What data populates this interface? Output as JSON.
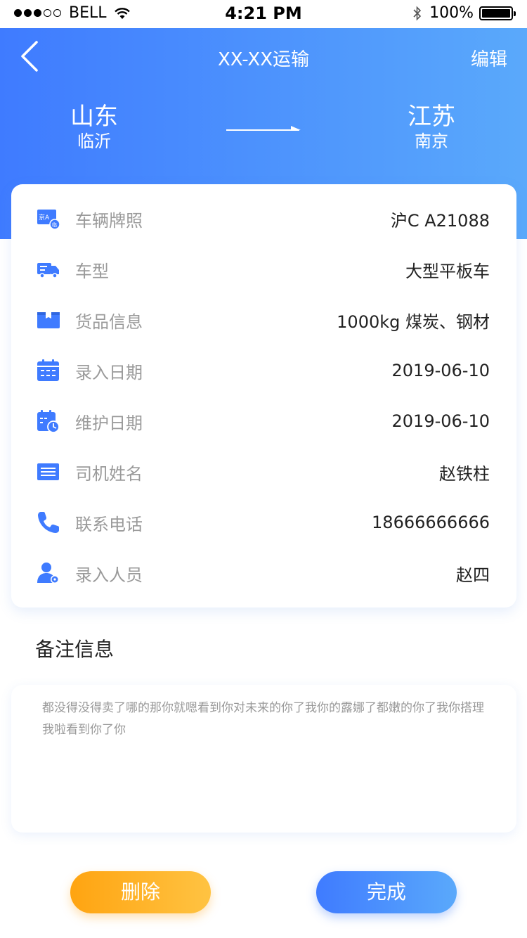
{
  "status_bar": {
    "carrier": "BELL",
    "time": "4:21 PM",
    "battery": "100%"
  },
  "header": {
    "title": "XX-XX运输",
    "edit_label": "编辑",
    "from": {
      "province": "山东",
      "city": "临沂"
    },
    "to": {
      "province": "江苏",
      "city": "南京"
    }
  },
  "info": {
    "rows": [
      {
        "label": "车辆牌照",
        "value": "沪C A21088",
        "icon": "license-plate-icon"
      },
      {
        "label": "车型",
        "value": "大型平板车",
        "icon": "truck-icon"
      },
      {
        "label": "货品信息",
        "value": "1000kg  煤炭、钢材",
        "icon": "package-icon"
      },
      {
        "label": "录入日期",
        "value": "2019-06-10",
        "icon": "calendar-icon"
      },
      {
        "label": "维护日期",
        "value": "2019-06-10",
        "icon": "calendar-clock-icon"
      },
      {
        "label": "司机姓名",
        "value": "赵铁柱",
        "icon": "id-card-icon"
      },
      {
        "label": "联系电话",
        "value": "18666666666",
        "icon": "phone-icon"
      },
      {
        "label": "录入人员",
        "value": "赵四",
        "icon": "user-settings-icon"
      }
    ]
  },
  "remark": {
    "title": "备注信息",
    "text": "都没得没得卖了哪的那你就嗯看到你对未来的你了我你的露娜了都嫩的你了我你搭理我啦看到你了你"
  },
  "actions": {
    "delete_label": "删除",
    "done_label": "完成"
  },
  "colors": {
    "primary": "#3f7bff",
    "primary_light": "#5aa9fb",
    "warning": "#ffa411",
    "label_gray": "#9a9a9a"
  }
}
